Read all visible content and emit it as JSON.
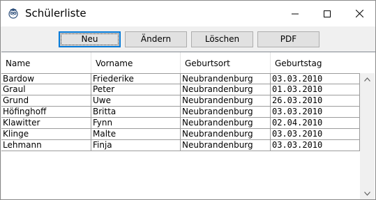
{
  "window": {
    "title": "Schülerliste",
    "icon": "owl-app-icon"
  },
  "toolbar": {
    "buttons": [
      {
        "label": "Neu",
        "default": true
      },
      {
        "label": "Ändern"
      },
      {
        "label": "Löschen"
      },
      {
        "label": "PDF"
      }
    ]
  },
  "table": {
    "columns": [
      "Name",
      "Vorname",
      "Geburtsort",
      "Geburtstag"
    ],
    "rows": [
      [
        "Bardow",
        "Friederike",
        "Neubrandenburg",
        "03.03.2010"
      ],
      [
        "Graul",
        "Peter",
        "Neubrandenburg",
        "01.03.2010"
      ],
      [
        "Grund",
        "Uwe",
        "Neubrandenburg",
        "26.03.2010"
      ],
      [
        "Höfinghoff",
        "Britta",
        "Neubrandenburg",
        "03.03.2010"
      ],
      [
        "Klawitter",
        "Fynn",
        "Neubrandenburg",
        "02.04.2010"
      ],
      [
        "Klinge",
        "Malte",
        "Neubrandenburg",
        "03.03.2010"
      ],
      [
        "Lehmann",
        "Finja",
        "Neubrandenburg",
        "03.03.2010"
      ]
    ]
  }
}
